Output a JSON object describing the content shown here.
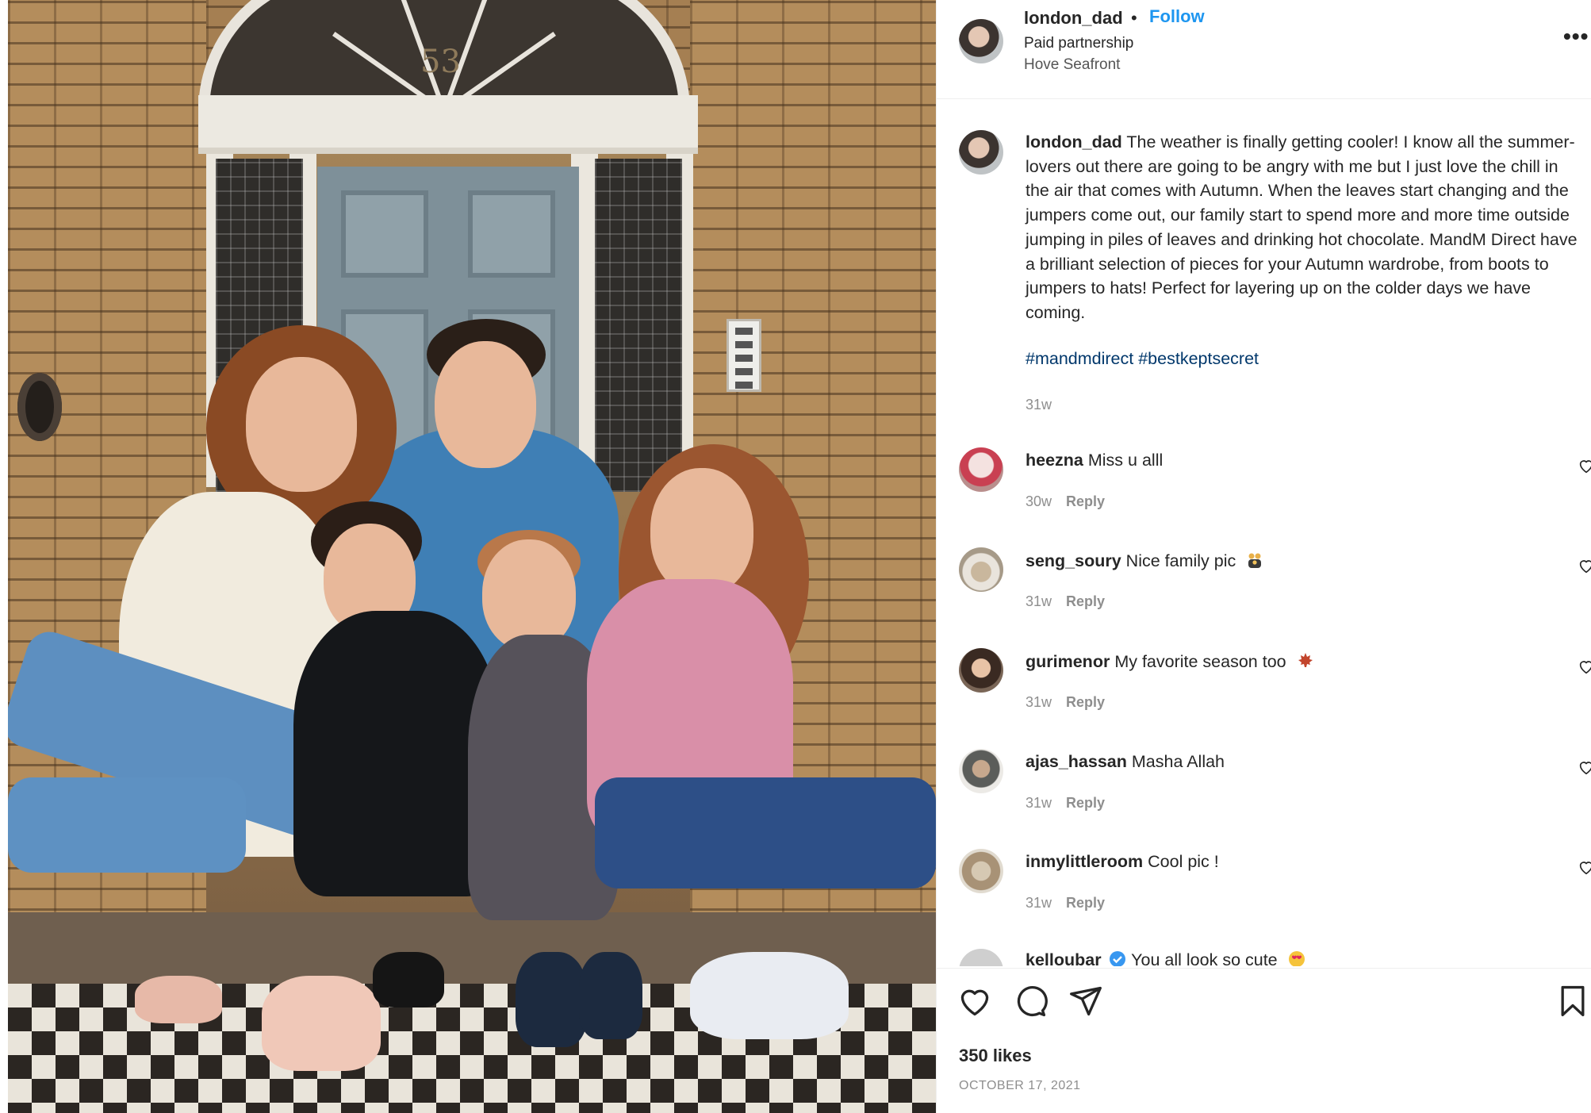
{
  "post": {
    "photo_alt": "Family of five sitting on front steps",
    "door_number": "53"
  },
  "header": {
    "username": "london_dad",
    "separator": "•",
    "follow_label": "Follow",
    "paid_label": "Paid partnership",
    "location": "Hove Seafront",
    "more_icon": "more-dots-icon"
  },
  "caption": {
    "username": "london_dad",
    "text": "The weather is finally getting cooler! I know all the summer-lovers out there are going to be angry with me but I just love the chill in the air that comes with Autumn. When the leaves start changing and the jumpers come out, our family start to spend more and more time outside jumping in piles of leaves and drinking hot chocolate. MandM Direct have a brilliant selection of pieces for your Autumn wardrobe, from boots to jumpers to hats! Perfect for layering up on the colder days we have coming.",
    "hashtags": [
      "#mandmdirect",
      "#bestkeptsecret"
    ],
    "time": "31w"
  },
  "comments": [
    {
      "username": "heezna",
      "text": "Miss u alll",
      "time": "30w",
      "reply": "Reply",
      "emoji": ""
    },
    {
      "username": "seng_soury",
      "text": "Nice family pic",
      "time": "31w",
      "reply": "Reply",
      "emoji": "family-emoji"
    },
    {
      "username": "gurimenor",
      "text": "My favorite season too",
      "time": "31w",
      "reply": "Reply",
      "emoji": "maple-leaf-emoji"
    },
    {
      "username": "ajas_hassan",
      "text": "Masha Allah",
      "time": "31w",
      "reply": "Reply",
      "emoji": ""
    },
    {
      "username": "inmylittleroom",
      "text": "Cool pic !",
      "time": "31w",
      "reply": "Reply",
      "emoji": ""
    },
    {
      "username": "kelloubar",
      "text": "You all look so cute",
      "time": "",
      "reply": "",
      "emoji": "heart-eyes-emoji"
    }
  ],
  "actions": {
    "like_icon": "heart-icon",
    "comment_icon": "comment-icon",
    "share_icon": "send-icon",
    "save_icon": "bookmark-icon"
  },
  "likes": "350 likes",
  "date": "OCTOBER 17, 2021",
  "colors": {
    "link_blue": "#1e96f0",
    "hashtag_blue": "#00376b",
    "muted": "#8e8e8e",
    "text": "#262626",
    "verified": "#3897f0"
  }
}
